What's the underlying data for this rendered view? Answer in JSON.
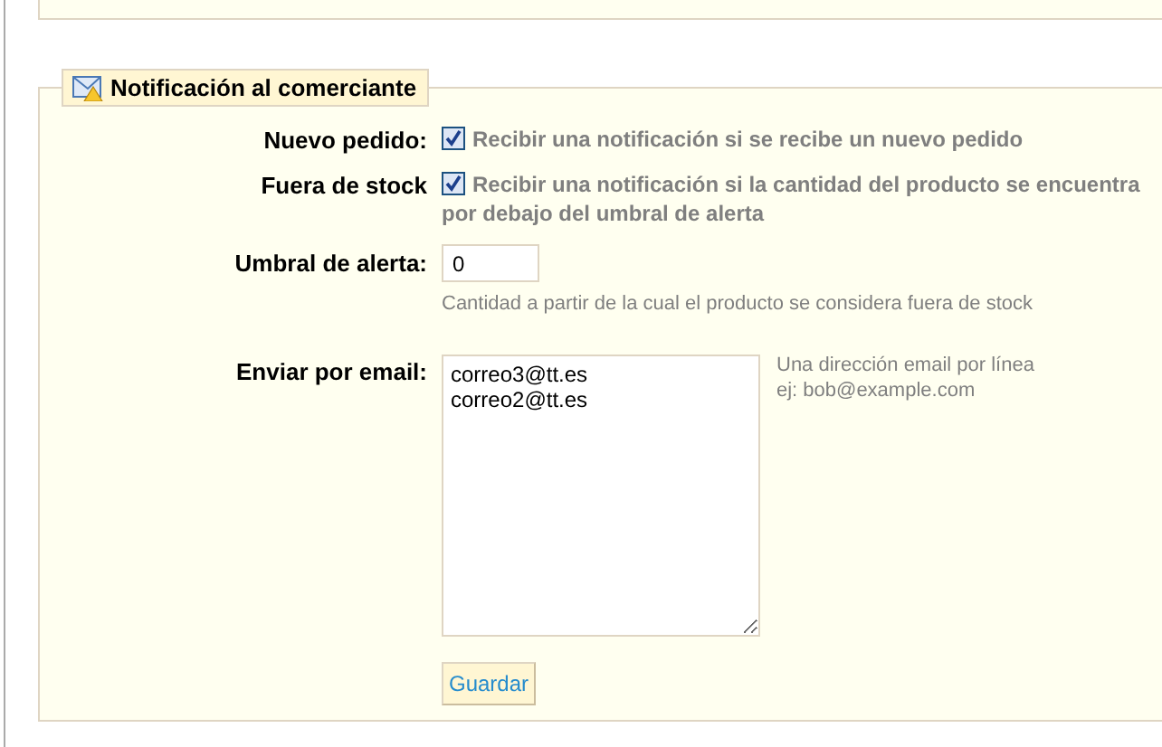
{
  "section": {
    "legend": "Notificación al comerciante"
  },
  "fields": [
    {
      "kind": "checkbox",
      "label": "Nuevo pedido:",
      "checked": true,
      "text": "Recibir una notificación si se recibe un nuevo pedido"
    },
    {
      "kind": "checkbox",
      "label": "Fuera de stock",
      "checked": true,
      "text": "Recibir una notificación si la cantidad del producto se encuentra por debajo del umbral de alerta"
    },
    {
      "kind": "number",
      "label": "Umbral de alerta:",
      "value": "0",
      "hint": "Cantidad a partir de la cual el producto se considera fuera de stock"
    },
    {
      "kind": "textarea",
      "label": "Enviar por email:",
      "value": "correo3@tt.es\ncorreo2@tt.es",
      "hint_lines": [
        "Una dirección email por línea",
        "ej: bob@example.com"
      ]
    }
  ],
  "button": "Guardar"
}
